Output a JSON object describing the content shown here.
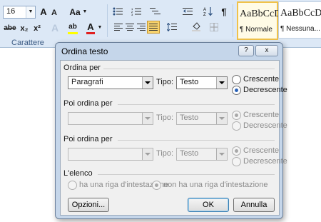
{
  "ribbon": {
    "font_size_value": "16",
    "grow_font": "A",
    "shrink_font": "A",
    "change_case": "Aa",
    "strikethrough": "abe",
    "subscript": "x₂",
    "superscript": "x²",
    "text_effects": "A",
    "highlight": "ab",
    "font_color": "A",
    "group_label_carattere": "Carattere",
    "pilcrow": "¶",
    "style_sample_1": "AaBbCcD",
    "style_name_1": "¶ Normale",
    "style_sample_2": "AaBbCcD",
    "style_name_2": "¶ Nessuna..."
  },
  "dialog": {
    "title": "Ordina testo",
    "help_button": "?",
    "close_button": "x",
    "sort_by": {
      "label": "Ordina per",
      "field_value": "Paragrafi",
      "type_label": "Tipo:",
      "type_value": "Testo",
      "ascending": "Crescente",
      "descending": "Decrescente"
    },
    "then_by_1": {
      "label": "Poi ordina per",
      "field_value": "",
      "type_label": "Tipo:",
      "type_value": "Testo",
      "ascending": "Crescente",
      "descending": "Decrescente"
    },
    "then_by_2": {
      "label": "Poi ordina per",
      "field_value": "",
      "type_label": "Tipo:",
      "type_value": "Testo",
      "ascending": "Crescente",
      "descending": "Decrescente"
    },
    "list": {
      "label": "L'elenco",
      "has_header": "ha una riga d'intestazione",
      "no_header": "non ha una riga d'intestazione"
    },
    "options_button": "Opzioni...",
    "ok_button": "OK",
    "cancel_button": "Annulla"
  },
  "colors": {
    "ribbon_bg": "#dce8f6",
    "dialog_frame": "#c5d6ea",
    "client_bg": "#f0f0f0",
    "highlight_yellow": "#ffff00",
    "font_color_red": "#e02020",
    "selected_style_border": "#f0c24a"
  }
}
